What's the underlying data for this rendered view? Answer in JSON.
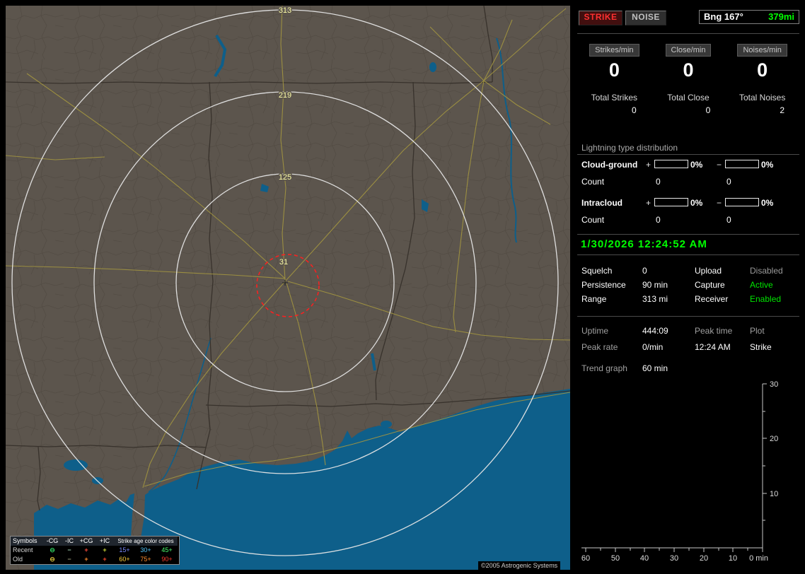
{
  "map": {
    "rings": [
      {
        "label": "313"
      },
      {
        "label": "219"
      },
      {
        "label": "125"
      },
      {
        "label": "31"
      }
    ],
    "ring_label_color": "#ffffa8",
    "close_alarm_color": "#ff1f1f",
    "water_color": "#0e5f8a",
    "road_color": "#a29540",
    "land_color": "#5c554d",
    "copyright": "©2005 Astrogenic Systems",
    "legend": {
      "symbols_header": "Symbols",
      "columns": [
        "-CG",
        "-IC",
        "+CG",
        "+IC"
      ],
      "age_header": "Strike age color codes",
      "rows": [
        {
          "label": "Recent",
          "symbols": [
            {
              "glyph": "⊖",
              "color": "#2fd060"
            },
            {
              "glyph": "−",
              "color": "#9fd0b0"
            },
            {
              "glyph": "+",
              "color": "#ff4b3e"
            },
            {
              "glyph": "+",
              "color": "#cddc39"
            }
          ],
          "ages": [
            {
              "text": "15+",
              "color": "#7b8bff"
            },
            {
              "text": "30+",
              "color": "#53c8ff"
            },
            {
              "text": "45+",
              "color": "#4bff6e"
            }
          ]
        },
        {
          "label": "Old",
          "symbols": [
            {
              "glyph": "⊖",
              "color": "#d6c23a"
            },
            {
              "glyph": "−",
              "color": "#9a9a7a"
            },
            {
              "glyph": "+",
              "color": "#ff8c2e"
            },
            {
              "glyph": "+",
              "color": "#ff4b2e"
            }
          ],
          "ages": [
            {
              "text": "60+",
              "color": "#ffd23a"
            },
            {
              "text": "75+",
              "color": "#ff8c2e"
            },
            {
              "text": "90+",
              "color": "#ff3b2e"
            }
          ]
        }
      ]
    }
  },
  "panel": {
    "strike_button": "STRIKE",
    "noise_button": "NOISE",
    "strike_color": "#ff3030",
    "bearing_label": "Bng 167°",
    "bearing_range": "379mi",
    "bearing_range_color": "#00ff00",
    "rate_counters": [
      {
        "label": "Strikes/min",
        "value": "0"
      },
      {
        "label": "Close/min",
        "value": "0"
      },
      {
        "label": "Noises/min",
        "value": "0"
      }
    ],
    "totals": [
      {
        "label": "Total Strikes",
        "value": "0"
      },
      {
        "label": "Total Close",
        "value": "0"
      },
      {
        "label": "Total Noises",
        "value": "2"
      }
    ],
    "distribution": {
      "title": "Lightning type distribution",
      "plus_sign": "+",
      "minus_sign": "−",
      "count_label": "Count",
      "rows": [
        {
          "label": "Cloud-ground",
          "plus_pct": "0%",
          "minus_pct": "0%",
          "plus_count": "0",
          "minus_count": "0"
        },
        {
          "label": "Intracloud",
          "plus_pct": "0%",
          "minus_pct": "0%",
          "plus_count": "0",
          "minus_count": "0"
        }
      ]
    },
    "timestamp": "1/30/2026 12:24:52 AM",
    "timestamp_color": "#00ff00",
    "settings": [
      {
        "label": "Squelch",
        "value": "0",
        "label2": "Upload",
        "value2": "Disabled",
        "value2_color": "#9a9a9a"
      },
      {
        "label": "Persistence",
        "value": "90 min",
        "label2": "Capture",
        "value2": "Active",
        "value2_color": "#00e600"
      },
      {
        "label": "Range",
        "value": "313 mi",
        "label2": "Receiver",
        "value2": "Enabled",
        "value2_color": "#00e600"
      }
    ],
    "status": {
      "rows": [
        {
          "c1": "Uptime",
          "v1": "444:09",
          "c2": "Peak time",
          "v2": "Plot"
        },
        {
          "c1": "Peak rate",
          "v1": "0/min",
          "c2": "12:24 AM",
          "v2": "Strike"
        }
      ]
    },
    "trend": {
      "label": "Trend graph",
      "window": "60 min",
      "chart": {
        "type": "line",
        "series": [],
        "y_ticks": [
          "30",
          "20",
          "10"
        ],
        "x_ticks": [
          "60",
          "50",
          "40",
          "30",
          "20",
          "10"
        ],
        "x_end_label": "0 min",
        "y_range": [
          0,
          30
        ],
        "x_range_minutes": [
          60,
          0
        ]
      }
    }
  }
}
